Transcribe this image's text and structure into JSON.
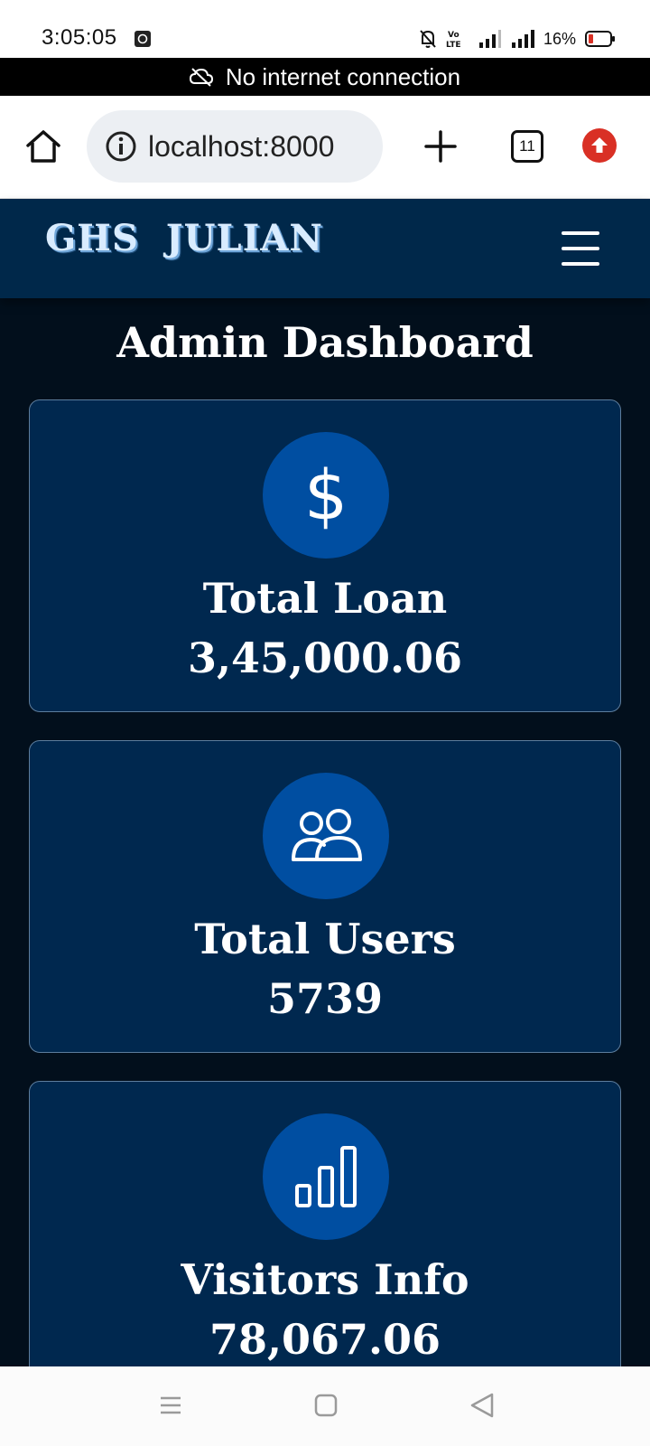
{
  "status_bar": {
    "time": "3:05:05",
    "battery": "16%",
    "icons": [
      "photo-app-icon",
      "mute-bell-icon",
      "volte-icon",
      "signal-icon",
      "signal-icon",
      "battery-icon"
    ]
  },
  "offline_banner": {
    "text": "No internet connection",
    "icon": "cloud-off-icon"
  },
  "browser": {
    "url": "localhost:8000",
    "tab_count": "11",
    "icons": [
      "home-icon",
      "info-icon",
      "plus-icon",
      "tabs-icon",
      "update-icon"
    ]
  },
  "site": {
    "brand": "GHS  JULIAN",
    "menu_icon": "hamburger-icon"
  },
  "dashboard": {
    "title": "Admin Dashboard",
    "cards": [
      {
        "icon": "dollar-icon",
        "label": "Total Loan",
        "value": "3,45,000.06"
      },
      {
        "icon": "users-icon",
        "label": "Total Users",
        "value": "5739"
      },
      {
        "icon": "bar-chart-icon",
        "label": "Visitors Info",
        "value": "78,067.06"
      }
    ]
  },
  "colors": {
    "page_bg": "#020f1c",
    "header_bg": "#00284a",
    "card_bg": "#00284f",
    "card_icon_bg": "#004ea1",
    "alert_red": "#d93025"
  }
}
